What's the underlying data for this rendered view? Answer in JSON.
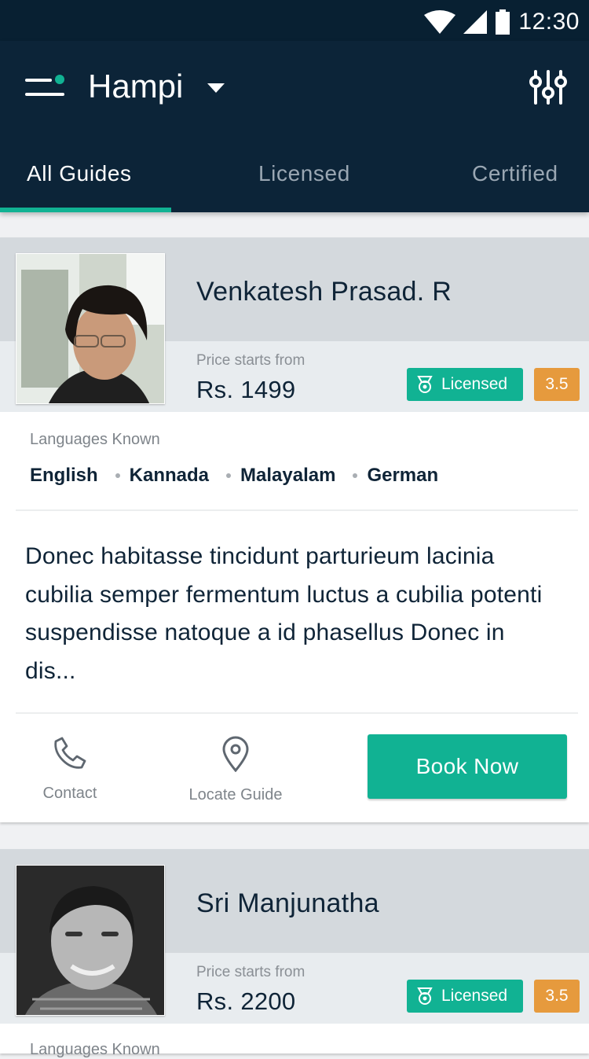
{
  "status_bar": {
    "time": "12:30"
  },
  "header": {
    "city": "Hampi"
  },
  "tabs": [
    {
      "label": "All Guides",
      "active": true
    },
    {
      "label": "Licensed",
      "active": false
    },
    {
      "label": "Certified",
      "active": false
    }
  ],
  "common": {
    "price_label": "Price starts from",
    "languages_label": "Languages Known",
    "contact_label": "Contact",
    "locate_label": "Locate Guide",
    "book_label": "Book Now"
  },
  "guides": [
    {
      "name": "Venkatesh Prasad. R",
      "price": "Rs. 1499",
      "badge": "Licensed",
      "rating": "3.5",
      "languages": [
        "English",
        "Kannada",
        "Malayalam",
        "German"
      ],
      "description": "Donec habitasse tincidunt parturieum lacinia cubilia semper fermentum luctus a cubilia potenti suspendisse natoque a id phasellus Donec  in dis..."
    },
    {
      "name": "Sri Manjunatha",
      "price": "Rs. 2200",
      "badge": "Licensed",
      "rating": "3.5",
      "languages_label_partial": "Languages Known"
    }
  ],
  "colors": {
    "primary_dark": "#0c2438",
    "accent": "#11b293",
    "rating": "#e69a3d"
  }
}
